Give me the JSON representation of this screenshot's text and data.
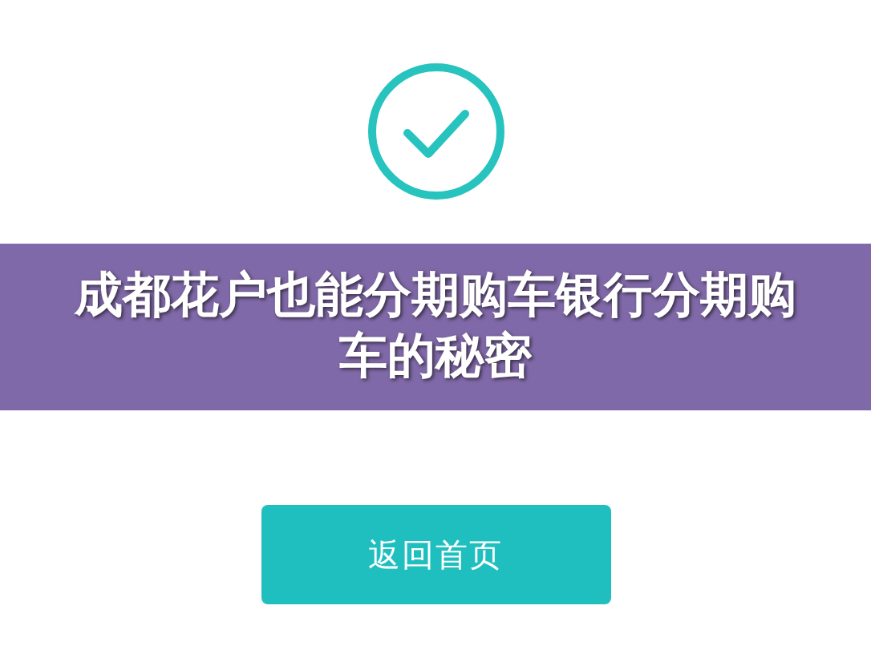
{
  "banner": {
    "title": "成都花户也能分期购车银行分期购车的秘密"
  },
  "button": {
    "label": "返回首页"
  }
}
